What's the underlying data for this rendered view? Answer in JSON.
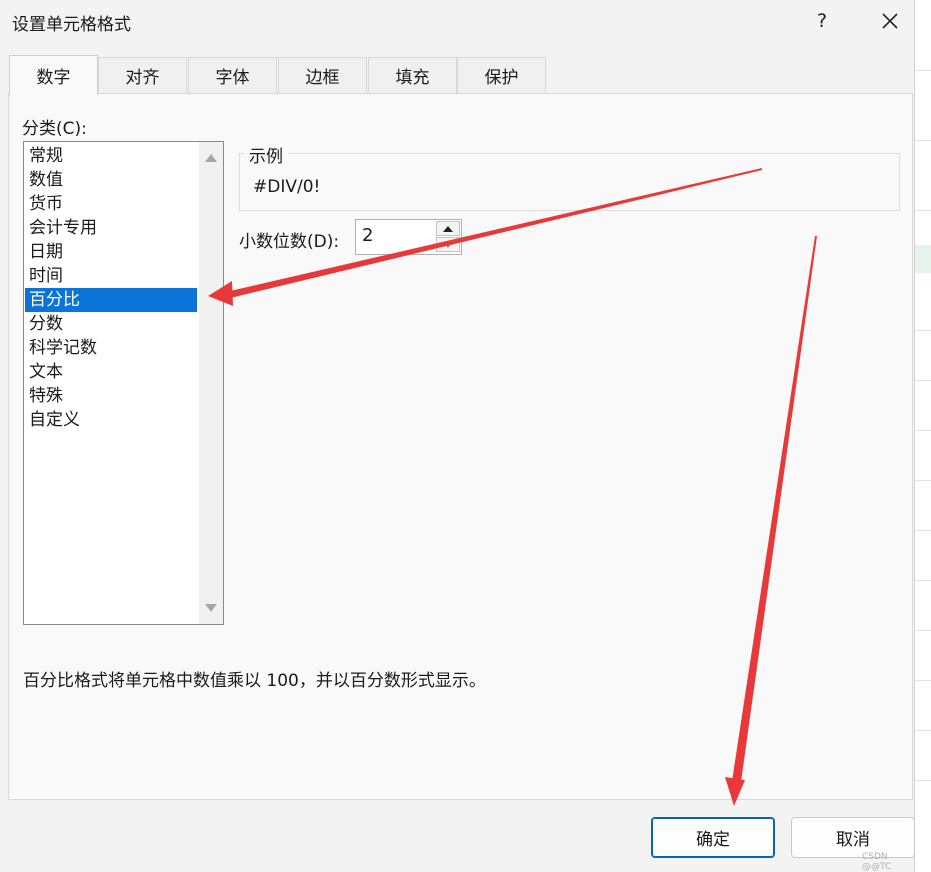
{
  "window": {
    "title": "设置单元格格式",
    "help_label": "?",
    "close_icon": "close-icon"
  },
  "tabs": [
    {
      "label": "数字",
      "active": true
    },
    {
      "label": "对齐",
      "active": false
    },
    {
      "label": "字体",
      "active": false
    },
    {
      "label": "边框",
      "active": false
    },
    {
      "label": "填充",
      "active": false
    },
    {
      "label": "保护",
      "active": false
    }
  ],
  "category": {
    "label": "分类(C):",
    "items": [
      "常规",
      "数值",
      "货币",
      "会计专用",
      "日期",
      "时间",
      "百分比",
      "分数",
      "科学记数",
      "文本",
      "特殊",
      "自定义"
    ],
    "selected": "百分比"
  },
  "sample": {
    "label": "示例",
    "value": "#DIV/0!"
  },
  "decimal_places": {
    "label": "小数位数(D):",
    "value": "2"
  },
  "description": "百分比格式将单元格中数值乘以 100，并以百分数形式显示。",
  "buttons": {
    "ok": "确定",
    "cancel": "取消"
  },
  "watermark": "CSDN @@TC",
  "colors": {
    "selection": "#0a74d8",
    "annotation_arrow": "#e8393a",
    "ok_border": "#0a62b8"
  }
}
